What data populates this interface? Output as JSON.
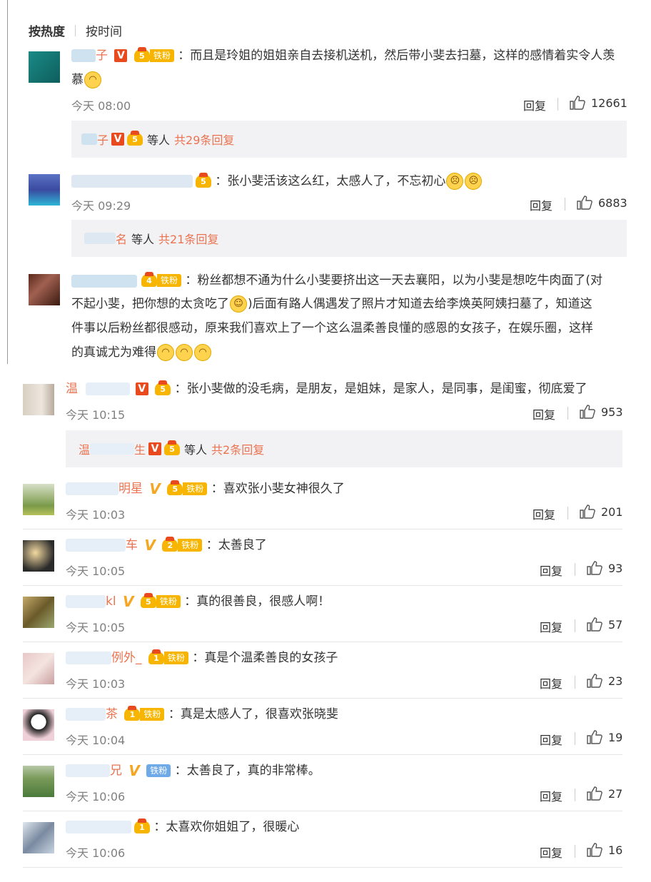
{
  "sort": {
    "hot": "按热度",
    "time": "按时间"
  },
  "reply_label": "回复",
  "comments": [
    {
      "name_visible": "子",
      "lines": [
        "：而且是玲姐的姐姐亲自去接机送机，然后带小斐去扫墓，这样的感情着实令人羡",
        "慕"
      ],
      "time": "今天 08:00",
      "likes": "12661",
      "sub": {
        "name": "子",
        "text": "等人",
        "more": "共29条回复"
      }
    },
    {
      "name_visible": "",
      "lines": [
        "：张小斐活该这么红，太感人了，不忘初心"
      ],
      "time": "今天 09:29",
      "likes": "6883",
      "sub": {
        "name": "名",
        "text": "等人",
        "more": "共21条回复"
      }
    },
    {
      "name_visible": "",
      "lines": [
        "：粉丝都想不通为什么小斐要挤出这一天去襄阳，以为小斐是想吃牛肉面了(对",
        "不起小斐，把你想的太贪吃了",
        ")后面有路人偶遇发了照片才知道去给李焕英阿姨扫墓了，知道这",
        "件事以后粉丝都很感动，原来我们喜欢上了一个这么温柔善良懂的感恩的女孩子，在娱乐圈，这样",
        "的真诚尤为难得"
      ],
      "time": "",
      "likes": ""
    },
    {
      "name_visible": "温",
      "lines": [
        "：张小斐做的没毛病，是朋友，是姐妹，是家人，是同事，是闺蜜，彻底爱了"
      ],
      "time": "今天 10:15",
      "likes": "953",
      "sub": {
        "name_a": "温",
        "name_b": "生",
        "text": "等人",
        "more": "共2条回复"
      }
    },
    {
      "name_visible": "明星",
      "lines": [
        "：喜欢张小斐女神很久了"
      ],
      "time": "今天 10:03",
      "likes": "201"
    },
    {
      "name_visible": "车",
      "lines": [
        "：太善良了"
      ],
      "time": "今天 10:05",
      "likes": "93"
    },
    {
      "name_visible": "kl",
      "lines": [
        "：真的很善良，很感人啊！"
      ],
      "time": "今天 10:05",
      "likes": "57"
    },
    {
      "name_visible": "例外_",
      "lines": [
        "：真是个温柔善良的女孩子"
      ],
      "time": "今天 10:03",
      "likes": "23"
    },
    {
      "name_visible": "茶",
      "lines": [
        "：真是太感人了，很喜欢张晓斐"
      ],
      "time": "今天 10:04",
      "likes": "19"
    },
    {
      "name_visible": "兄",
      "lines": [
        "：太善良了，真的非常棒。"
      ],
      "time": "今天 10:06",
      "likes": "27"
    },
    {
      "name_visible": "",
      "lines": [
        "：太喜欢你姐姐了，很暖心"
      ],
      "time": "今天 10:06",
      "likes": "16"
    }
  ],
  "badges": {
    "iron_fan": "铁粉",
    "v": "V"
  },
  "colors": {
    "accent": "#eb7350",
    "gold": "#f7b500",
    "v_red": "#e8491d"
  },
  "icons": {
    "like": "thumbs-up-icon",
    "emoji_cry": "crying-emoji",
    "emoji_sad": "sad-emoji",
    "emoji_laugh": "laughing-emoji"
  }
}
